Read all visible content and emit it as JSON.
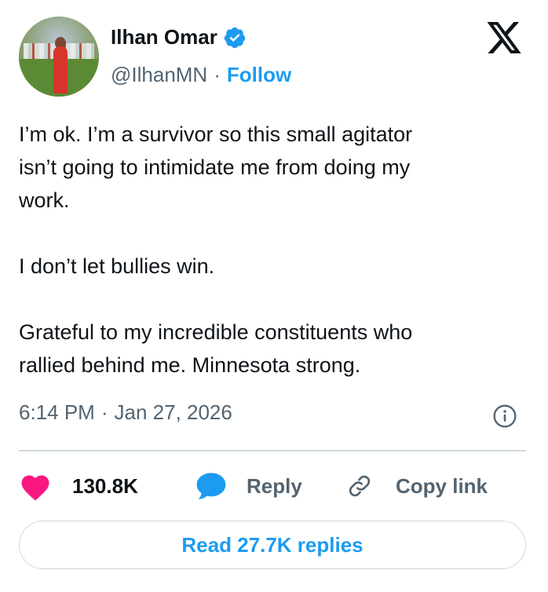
{
  "author": {
    "name": "Ilhan Omar",
    "handle": "@IlhanMN",
    "separator": "·",
    "follow_label": "Follow"
  },
  "tweet": {
    "text": "I’m ok. I’m a survivor so this small agitator\nisn’t going to intimidate me from doing my\nwork.\n\nI don’t let bullies win.\n\nGrateful to my incredible constituents who\nrallied behind me. Minnesota strong.",
    "time": "6:14 PM",
    "separator": "·",
    "date": "Jan 27, 2026"
  },
  "actions": {
    "likes": "130.8K",
    "reply_label": "Reply",
    "copy_link_label": "Copy link"
  },
  "read_replies_label": "Read 27.7K replies",
  "icons": {
    "logo": "x-logo-icon",
    "verified": "verified-badge-icon",
    "info": "info-icon",
    "like": "heart-icon",
    "reply": "speech-bubble-icon",
    "copy": "link-icon"
  },
  "colors": {
    "accent": "#1d9bf0",
    "like": "#f91880",
    "text": "#0f1419",
    "muted": "#536471",
    "border": "#cfd9de"
  }
}
